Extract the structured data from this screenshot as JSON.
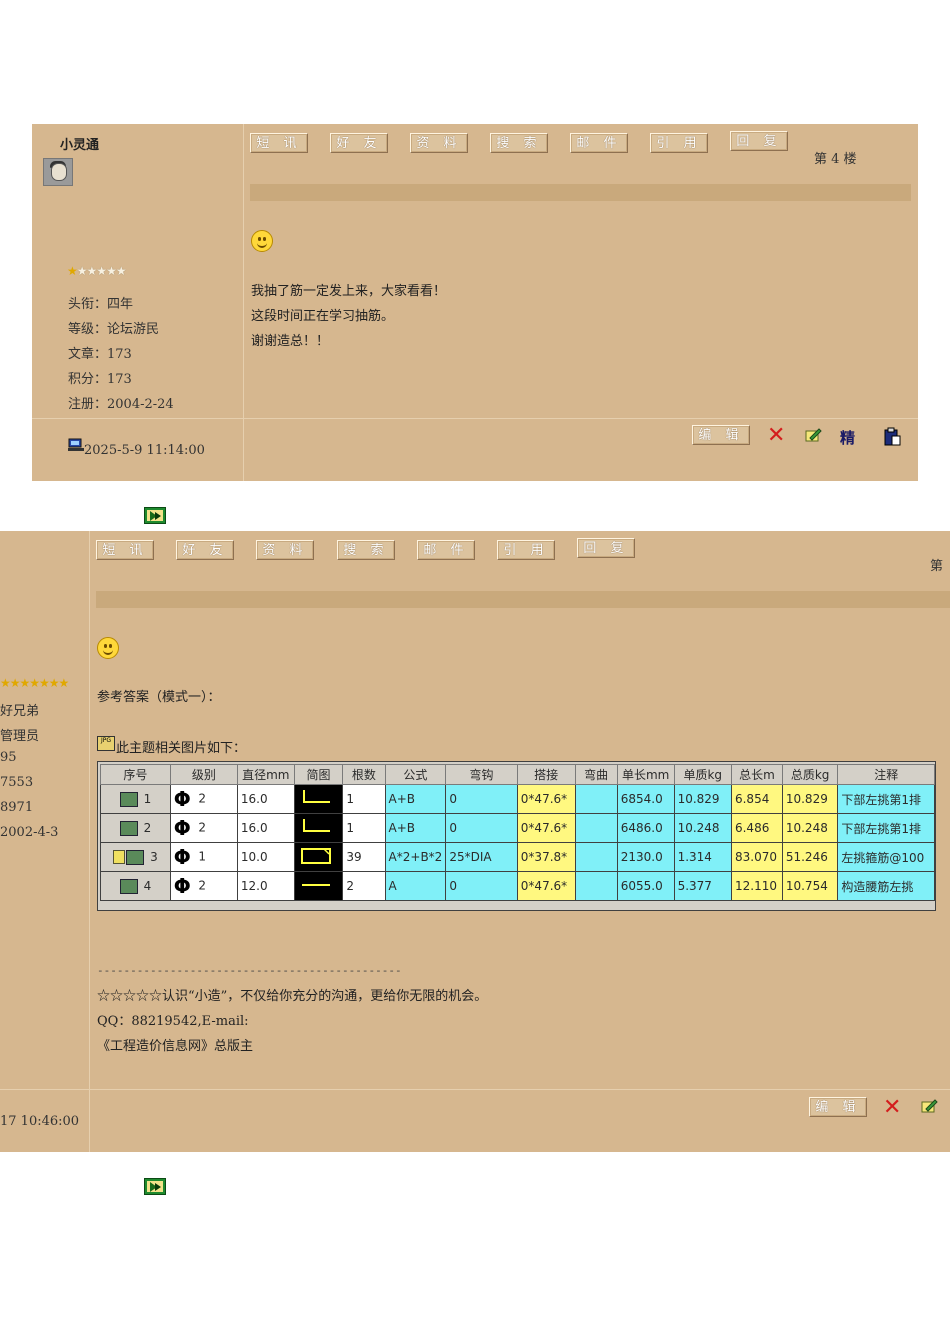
{
  "post1": {
    "username": "小灵通",
    "rank_stars": {
      "filled": 1,
      "total": 6
    },
    "info": [
      "头衔：四年",
      "等级：论坛游民",
      "文章：173",
      "积分：173",
      "注册：2004-2-24"
    ],
    "buttons": [
      "短 讯",
      "好 友",
      "资 料",
      "搜 索",
      "邮 件",
      "引 用",
      "回 复"
    ],
    "floor": "第 4 楼",
    "content": [
      "我抽了筋一定发上来，大家看看！",
      "这段时间正在学习抽筋。",
      "谢谢造总！！"
    ],
    "timestamp": "2025-5-9 11:14:00",
    "footer": {
      "edit": "编 辑",
      "jing": "精"
    }
  },
  "post2": {
    "rank_stars": {
      "filled": 7,
      "total": 7
    },
    "info": [
      "好兄弟",
      "管理员",
      "95",
      "7553",
      "8971",
      "2002-4-3"
    ],
    "buttons": [
      "短 讯",
      "好 友",
      "资 料",
      "搜 索",
      "邮 件",
      "引 用",
      "回 复"
    ],
    "floor": "第",
    "intro": "参考答案（模式一）：",
    "image_caption": "此主题相关图片如下：",
    "table": {
      "headers": [
        "序号",
        "级别",
        "直径mm",
        "简图",
        "根数",
        "公式",
        "弯钩",
        "搭接",
        "弯曲",
        "单长mm",
        "单质kg",
        "总长m",
        "总质kg",
        "注释"
      ],
      "rows": [
        {
          "seq": "1",
          "level": "2",
          "dia": "16.0",
          "shape": "L",
          "count": "1",
          "formula": "A+B",
          "hook": "0",
          "lap": "0*47.6*",
          "bend": "",
          "unit_len": "6854.0",
          "unit_mass": "10.829",
          "total_len": "6.854",
          "total_mass": "10.829",
          "note": "下部左挑第1排"
        },
        {
          "seq": "2",
          "level": "2",
          "dia": "16.0",
          "shape": "L",
          "count": "1",
          "formula": "A+B",
          "hook": "0",
          "lap": "0*47.6*",
          "bend": "",
          "unit_len": "6486.0",
          "unit_mass": "10.248",
          "total_len": "6.486",
          "total_mass": "10.248",
          "note": "下部左挑第1排"
        },
        {
          "seq": "3",
          "level": "1",
          "dia": "10.0",
          "shape": "rect",
          "count": "39",
          "formula": "A*2+B*2",
          "hook": "25*DIA",
          "lap": "0*37.8*",
          "bend": "",
          "unit_len": "2130.0",
          "unit_mass": "1.314",
          "total_len": "83.070",
          "total_mass": "51.246",
          "note": "左挑箍筋@100"
        },
        {
          "seq": "4",
          "level": "2",
          "dia": "12.0",
          "shape": "line",
          "count": "2",
          "formula": "A",
          "hook": "0",
          "lap": "0*47.6*",
          "bend": "",
          "unit_len": "6055.0",
          "unit_mass": "5.377",
          "total_len": "12.110",
          "total_mass": "10.754",
          "note": "构造腰筋左挑"
        }
      ]
    },
    "separator": "----------------------------------------------",
    "signature": [
      "☆☆☆☆☆认识“小造”，不仅给你充分的沟通，更给你无限的机会。",
      "QQ：88219542,E-mail:",
      "《工程造价信息网》总版主"
    ],
    "timestamp": "17 10:46:00",
    "footer": {
      "edit": "编 辑"
    }
  },
  "colors": {
    "post_bg": "#d6b78f",
    "title_bar": "#c9a97c",
    "cyan_cell": "#80f0f8",
    "yellow_cell": "#fff880"
  }
}
